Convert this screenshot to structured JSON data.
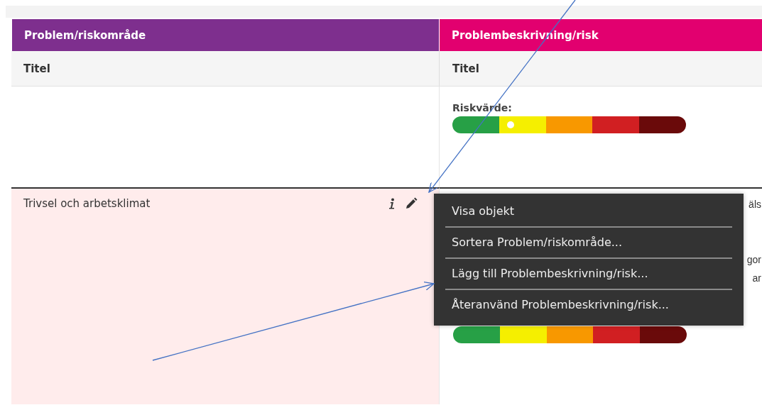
{
  "columns": [
    {
      "title": "Problem/riskområde",
      "color": "#7e2f8e"
    },
    {
      "title": "Problembeskrivning/risk",
      "color": "#e2006f"
    }
  ],
  "subheaders": [
    "Titel",
    "Titel"
  ],
  "risk": {
    "label": "Riskvärde:",
    "level": 0.25
  },
  "row": {
    "title": "Trivsel och arbetsklimat",
    "cut_texts": [
      "äls",
      "gor",
      "ar"
    ]
  },
  "menu": {
    "items": [
      "Visa objekt",
      "Sortera Problem/riskområde...",
      "Lägg till Problembeskrivning/risk...",
      "Återanvänd Problembeskrivning/risk..."
    ]
  }
}
